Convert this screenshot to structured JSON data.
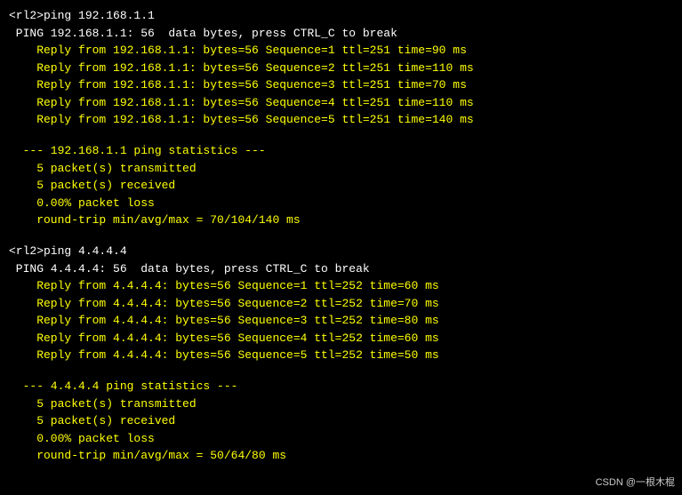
{
  "terminal": {
    "lines": [
      {
        "id": "cmd1",
        "text": "<rl2>ping 192.168.1.1",
        "indent": 0,
        "color": "white"
      },
      {
        "id": "ping1_header",
        "text": " PING 192.168.1.1: 56  data bytes, press CTRL_C to break",
        "indent": 0,
        "color": "white"
      },
      {
        "id": "ping1_r1",
        "text": "    Reply from 192.168.1.1: bytes=56 Sequence=1 ttl=251 time=90 ms",
        "indent": 0,
        "color": "yellow"
      },
      {
        "id": "ping1_r2",
        "text": "    Reply from 192.168.1.1: bytes=56 Sequence=2 ttl=251 time=110 ms",
        "indent": 0,
        "color": "yellow"
      },
      {
        "id": "ping1_r3",
        "text": "    Reply from 192.168.1.1: bytes=56 Sequence=3 ttl=251 time=70 ms",
        "indent": 0,
        "color": "yellow"
      },
      {
        "id": "ping1_r4",
        "text": "    Reply from 192.168.1.1: bytes=56 Sequence=4 ttl=251 time=110 ms",
        "indent": 0,
        "color": "yellow"
      },
      {
        "id": "ping1_r5",
        "text": "    Reply from 192.168.1.1: bytes=56 Sequence=5 ttl=251 time=140 ms",
        "indent": 0,
        "color": "yellow"
      },
      {
        "id": "blank1",
        "text": "",
        "indent": 0,
        "color": "yellow"
      },
      {
        "id": "ping1_stats_header",
        "text": "  --- 192.168.1.1 ping statistics ---",
        "indent": 0,
        "color": "yellow"
      },
      {
        "id": "ping1_tx",
        "text": "    5 packet(s) transmitted",
        "indent": 0,
        "color": "yellow"
      },
      {
        "id": "ping1_rx",
        "text": "    5 packet(s) received",
        "indent": 0,
        "color": "yellow"
      },
      {
        "id": "ping1_loss",
        "text": "    0.00% packet loss",
        "indent": 0,
        "color": "yellow"
      },
      {
        "id": "ping1_rtt",
        "text": "    round-trip min/avg/max = 70/104/140 ms",
        "indent": 0,
        "color": "yellow"
      },
      {
        "id": "blank2",
        "text": "",
        "indent": 0,
        "color": "yellow"
      },
      {
        "id": "cmd2",
        "text": "<rl2>ping 4.4.4.4",
        "indent": 0,
        "color": "white"
      },
      {
        "id": "ping2_header",
        "text": " PING 4.4.4.4: 56  data bytes, press CTRL_C to break",
        "indent": 0,
        "color": "white"
      },
      {
        "id": "ping2_r1",
        "text": "    Reply from 4.4.4.4: bytes=56 Sequence=1 ttl=252 time=60 ms",
        "indent": 0,
        "color": "yellow"
      },
      {
        "id": "ping2_r2",
        "text": "    Reply from 4.4.4.4: bytes=56 Sequence=2 ttl=252 time=70 ms",
        "indent": 0,
        "color": "yellow"
      },
      {
        "id": "ping2_r3",
        "text": "    Reply from 4.4.4.4: bytes=56 Sequence=3 ttl=252 time=80 ms",
        "indent": 0,
        "color": "yellow"
      },
      {
        "id": "ping2_r4",
        "text": "    Reply from 4.4.4.4: bytes=56 Sequence=4 ttl=252 time=60 ms",
        "indent": 0,
        "color": "yellow"
      },
      {
        "id": "ping2_r5",
        "text": "    Reply from 4.4.4.4: bytes=56 Sequence=5 ttl=252 time=50 ms",
        "indent": 0,
        "color": "yellow"
      },
      {
        "id": "blank3",
        "text": "",
        "indent": 0,
        "color": "yellow"
      },
      {
        "id": "ping2_stats_header",
        "text": "  --- 4.4.4.4 ping statistics ---",
        "indent": 0,
        "color": "yellow"
      },
      {
        "id": "ping2_tx",
        "text": "    5 packet(s) transmitted",
        "indent": 0,
        "color": "yellow"
      },
      {
        "id": "ping2_rx",
        "text": "    5 packet(s) received",
        "indent": 0,
        "color": "yellow"
      },
      {
        "id": "ping2_loss",
        "text": "    0.00% packet loss",
        "indent": 0,
        "color": "yellow"
      },
      {
        "id": "ping2_rtt",
        "text": "    round-trip min/avg/max = 50/64/80 ms",
        "indent": 0,
        "color": "yellow"
      }
    ],
    "watermark": "CSDN @一根木棍"
  }
}
